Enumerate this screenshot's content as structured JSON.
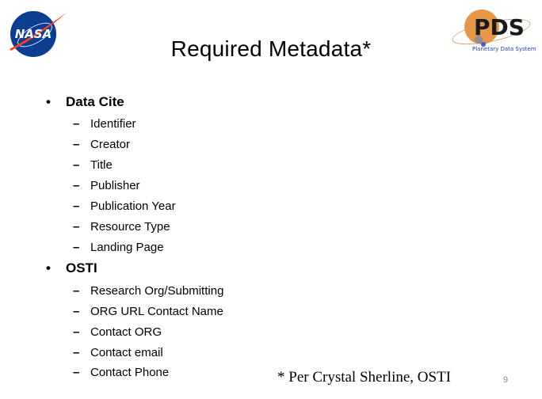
{
  "slide": {
    "title": "Required Metadata*",
    "logos": {
      "left": "NASA",
      "right": "PDS",
      "right_caption": "Planetary Data System"
    },
    "sections": [
      {
        "heading": "Data Cite",
        "items": [
          "Identifier",
          "Creator",
          "Title",
          "Publisher",
          "Publication Year",
          "Resource Type",
          "Landing Page"
        ]
      },
      {
        "heading": "OSTI",
        "items": [
          "Research Org/Submitting",
          "ORG URL Contact Name",
          "Contact ORG",
          "Contact email",
          "Contact Phone"
        ]
      }
    ],
    "bullet_glyph": "•",
    "dash_glyph": "–",
    "footnote": "* Per Crystal Sherline, OSTI",
    "page_number": "9"
  },
  "colors": {
    "nasa_blue": "#0b3d91",
    "nasa_red": "#fc3d21",
    "pds_orange": "#e8974a",
    "pds_text": "#1a1a1a"
  }
}
